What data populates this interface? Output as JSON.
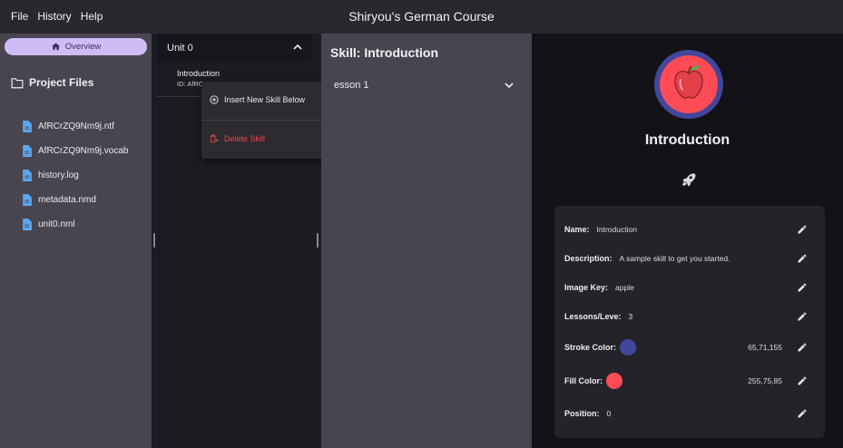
{
  "menu": {
    "file": "File",
    "history": "History",
    "help": "Help"
  },
  "app": {
    "title": "Shiryou's German Course"
  },
  "sidebar": {
    "overview_label": "Overview",
    "project_files_label": "Project Files",
    "files": [
      {
        "name": "AfRCrZQ9Nm9j.ntf"
      },
      {
        "name": "AfRCrZQ9Nm9j.vocab"
      },
      {
        "name": "history.log"
      },
      {
        "name": "metadata.nmd"
      },
      {
        "name": "unit0.nml"
      }
    ]
  },
  "units": {
    "unit_title": "Unit 0",
    "skill_name": "Introduction",
    "skill_id": "ID: AfRC"
  },
  "context_menu": {
    "insert_label": "Insert New Skill Below",
    "delete_label": "Delete Skill"
  },
  "skill_panel": {
    "title": "Skill: Introduction",
    "lesson_label": "esson 1"
  },
  "details": {
    "name_heading": "Introduction",
    "rows": {
      "name": {
        "label": "Name:",
        "value": "Introduction"
      },
      "description": {
        "label": "Description:",
        "value": "A sample skill to get you started."
      },
      "image_key": {
        "label": "Image Key:",
        "value": "apple"
      },
      "lessons": {
        "label": "Lessons/Leve:",
        "value": "3"
      },
      "stroke": {
        "label": "Stroke Color:",
        "value": "65,71,155"
      },
      "fill": {
        "label": "Fill Color:",
        "value": "255,75,85"
      },
      "position": {
        "label": "Position:",
        "value": "0"
      }
    }
  },
  "colors": {
    "accent": "#cfbcf5",
    "stroke_color": "#41479b",
    "fill_color": "#ff4b55",
    "danger": "#e5484d",
    "file_icon": "#5aa7f0"
  },
  "icons": {
    "overview": "home-icon",
    "project_files": "folder-icon",
    "file": "file-icon",
    "expand": "chevron-icon",
    "insert": "add-circle-icon",
    "delete": "delete-icon",
    "skill_image": "apple-icon",
    "rocket": "rocket-icon",
    "edit": "pencil-icon"
  }
}
